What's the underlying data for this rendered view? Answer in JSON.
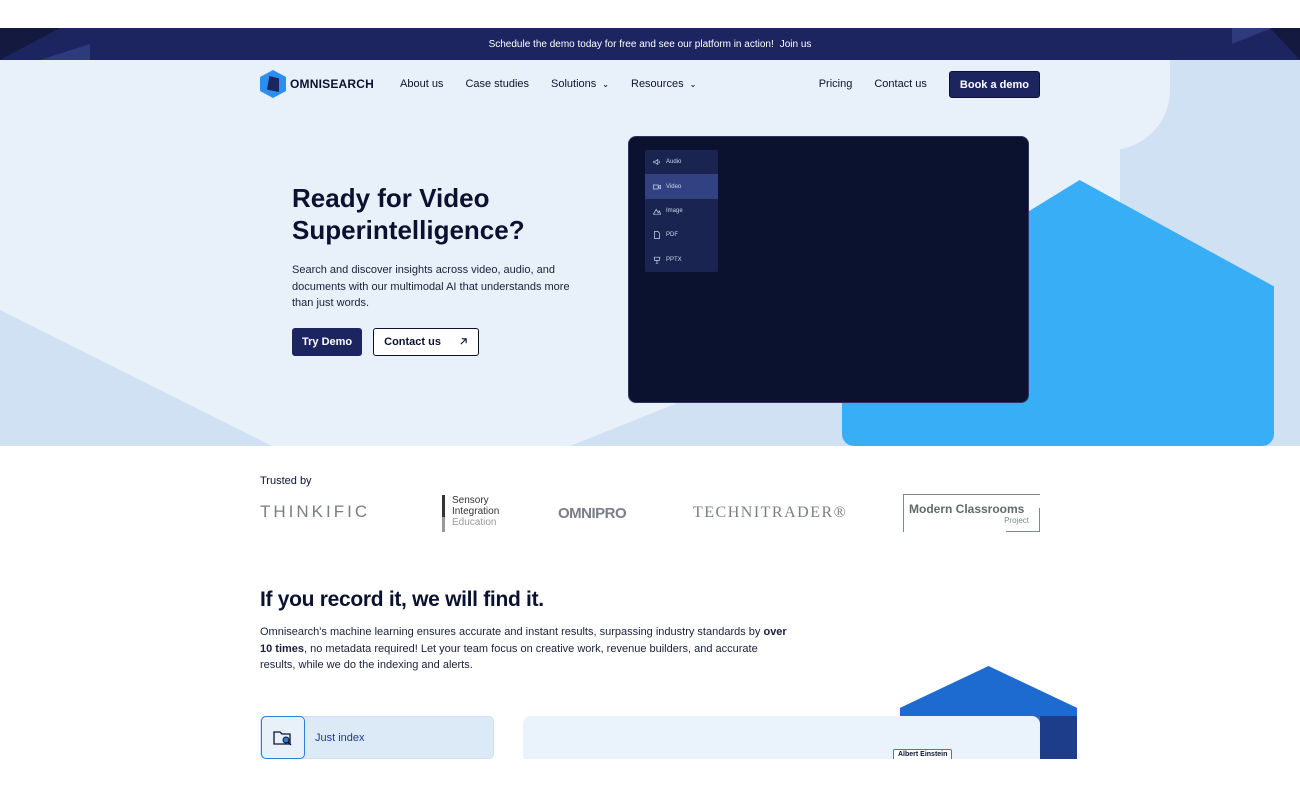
{
  "announcement": {
    "text": "Schedule the demo today for free and see our platform in action!",
    "link": "Join us"
  },
  "nav": {
    "logo_text": "OMNISEARCH",
    "links": [
      {
        "label": "About us"
      },
      {
        "label": "Case studies"
      },
      {
        "label": "Solutions"
      },
      {
        "label": "Resources"
      }
    ],
    "pricing": "Pricing",
    "contact": "Contact us",
    "cta": "Book a demo"
  },
  "hero": {
    "title_line1": "Ready for Video",
    "title_line2": "Superintelligence?",
    "subtitle": "Search and discover insights across video, audio, and documents with our multimodal AI that understands more than just words.",
    "primary_button": "Try Demo",
    "secondary_button": "Contact us"
  },
  "demo": {
    "menu": [
      {
        "label": "Audio",
        "icon": "speaker-icon"
      },
      {
        "label": "Video",
        "icon": "video-camera-icon",
        "active": true
      },
      {
        "label": "Image",
        "icon": "image-icon"
      },
      {
        "label": "PDF",
        "icon": "file-icon"
      },
      {
        "label": "PPTX",
        "icon": "presentation-icon"
      }
    ]
  },
  "trusted": {
    "label": "Trusted by",
    "logos": {
      "thinkific": "THINKIFIC",
      "sensory_1": "Sensory",
      "sensory_2": "Integration",
      "sensory_3": "Education",
      "omnipro": "OMNIPRO",
      "technitrader": "TECHNITRADER®",
      "mcp_1": "Modern Classrooms",
      "mcp_2": "Project"
    }
  },
  "section": {
    "title": "If you record it, we will find it.",
    "body_part1": "Omnisearch's machine learning ensures accurate and instant results, surpassing industry standards by ",
    "body_bold": "over 10 times",
    "body_part2": ", no metadata required! Let your team focus on creative work, revenue builders, and accurate results, while we do the indexing and alerts."
  },
  "feature_tab": {
    "label": "Just index",
    "icon": "folder-search-icon"
  },
  "panel": {
    "tag": "Albert Einstein"
  },
  "colors": {
    "navy": "#1d2561",
    "dark": "#0b1230",
    "hero_bg": "#e8f1fa",
    "accent_blue": "#38aef7"
  }
}
